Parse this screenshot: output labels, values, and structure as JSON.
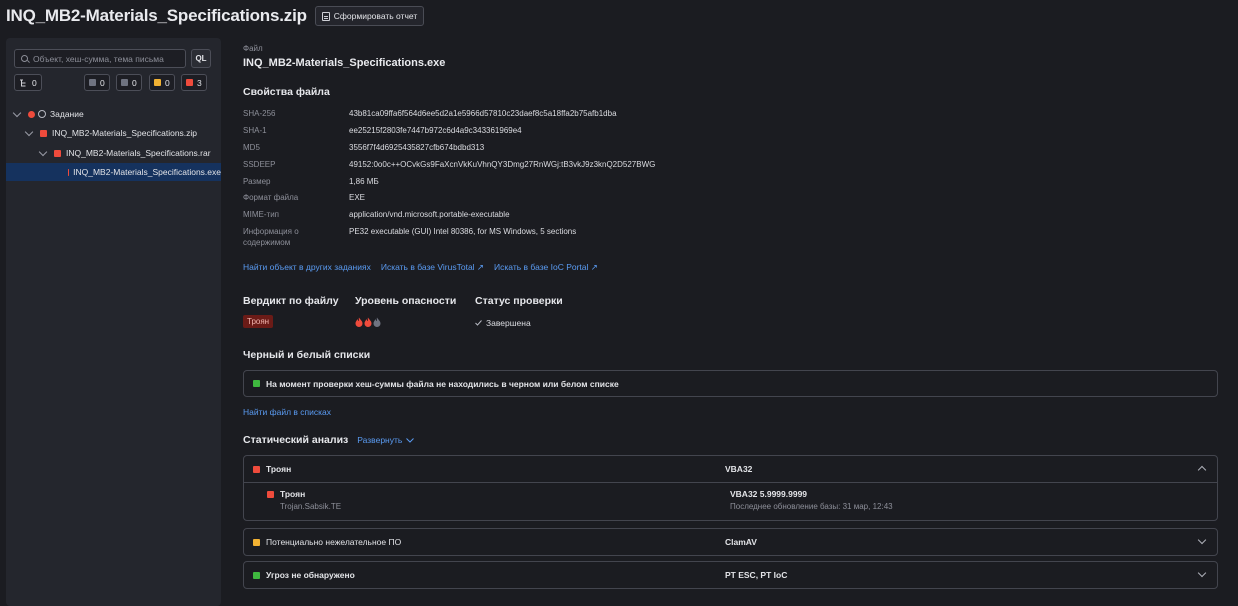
{
  "header": {
    "title": "INQ_MB2-Materials_Specifications.zip",
    "report_button": "Сформировать отчет"
  },
  "sidebar": {
    "search_placeholder": "Объект, хеш-сумма, тема письма",
    "ql_label": "QL",
    "chips": [
      {
        "count": "0",
        "icon": "tree-icon"
      },
      {
        "count": "0",
        "color": "#6f7380"
      },
      {
        "count": "0",
        "color": "#6f7380"
      },
      {
        "count": "0",
        "color": "#f2b233"
      },
      {
        "count": "3",
        "color": "#ef4b3c"
      }
    ],
    "tree": [
      {
        "label": "Задание"
      },
      {
        "label": "INQ_MB2-Materials_Specifications.zip"
      },
      {
        "label": "INQ_MB2-Materials_Specifications.rar"
      },
      {
        "label": "INQ_MB2-Materials_Specifications.exe"
      }
    ]
  },
  "file": {
    "caption": "Файл",
    "name": "INQ_MB2-Materials_Specifications.exe"
  },
  "properties": {
    "title": "Свойства файла",
    "rows": [
      {
        "key": "SHA-256",
        "value": "43b81ca09ffa6f564d6ee5d2a1e5966d57810c23daef8c5a18ffa2b75afb1dba"
      },
      {
        "key": "SHA-1",
        "value": "ee25215f2803fe7447b972c6d4a9c343361969e4"
      },
      {
        "key": "MD5",
        "value": "3556f7f4d6925435827cfb674bdbd313"
      },
      {
        "key": "SSDEEP",
        "value": "49152:0o0c++OCvkGs9FaXcnVkKuVhnQY3Dmg27RnWGj:tB3vkJ9z3knQ2D527BWG"
      },
      {
        "key": "Размер",
        "value": "1,86 МБ"
      },
      {
        "key": "Формат файла",
        "value": "EXE"
      },
      {
        "key": "MIME-тип",
        "value": "application/vnd.microsoft.portable-executable"
      },
      {
        "key": "Информация о содержимом",
        "value": "PE32 executable (GUI) Intel 80386, for MS Windows, 5 sections"
      }
    ]
  },
  "links": {
    "find_other": "Найти объект в других заданиях",
    "virustotal": "Искать в базе VirusTotal ↗",
    "ioc": "Искать в базе IoC Portal ↗"
  },
  "verdict": {
    "verdict_title": "Вердикт по файлу",
    "verdict_value": "Троян",
    "danger_title": "Уровень опасности",
    "danger_level": 2,
    "danger_max": 3,
    "status_title": "Статус проверки",
    "status_value": "Завершена"
  },
  "bw": {
    "title": "Черный и белый списки",
    "message": "На момент проверки хеш-суммы файла не находились в черном или белом списке",
    "find_link": "Найти файл в списках"
  },
  "static": {
    "title": "Статический анализ",
    "expand": "Развернуть",
    "items": [
      {
        "label": "Троян",
        "engine": "VBA32",
        "color": "#ef4b3c",
        "detail": {
          "name": "Троян",
          "sig": "Trojan.Sabsik.TE",
          "engine_version": "VBA32 5.9999.9999",
          "updated": "Последнее обновление базы: 31 мар, 12:43"
        }
      },
      {
        "label": "Потенциально нежелательное ПО",
        "engine": "ClamAV",
        "color": "#f2b233"
      },
      {
        "label": "Угроз не обнаружено",
        "engine": "PT ESC, PT IoC",
        "color": "#3fb83f"
      }
    ]
  }
}
